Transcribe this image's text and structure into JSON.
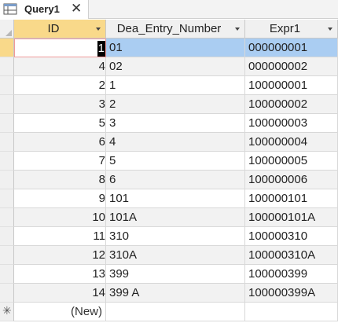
{
  "tab": {
    "title": "Query1",
    "close_glyph": "✕",
    "icon": "query-icon"
  },
  "columns": [
    {
      "label": "ID"
    },
    {
      "label": "Dea_Entry_Number"
    },
    {
      "label": "Expr1"
    }
  ],
  "rows": [
    {
      "id": "1",
      "dea": "01",
      "expr": "000000001"
    },
    {
      "id": "4",
      "dea": "02",
      "expr": "000000002"
    },
    {
      "id": "2",
      "dea": "1",
      "expr": "100000001"
    },
    {
      "id": "3",
      "dea": "2",
      "expr": "100000002"
    },
    {
      "id": "5",
      "dea": "3",
      "expr": "100000003"
    },
    {
      "id": "6",
      "dea": "4",
      "expr": "100000004"
    },
    {
      "id": "7",
      "dea": "5",
      "expr": "100000005"
    },
    {
      "id": "8",
      "dea": "6",
      "expr": "100000006"
    },
    {
      "id": "9",
      "dea": "101",
      "expr": "100000101"
    },
    {
      "id": "10",
      "dea": "101A",
      "expr": "100000101A"
    },
    {
      "id": "11",
      "dea": "310",
      "expr": "100000310"
    },
    {
      "id": "12",
      "dea": "310A",
      "expr": "100000310A"
    },
    {
      "id": "13",
      "dea": "399",
      "expr": "100000399"
    },
    {
      "id": "14",
      "dea": "399 A",
      "expr": "100000399A"
    }
  ],
  "new_row": {
    "marker": "✳",
    "id_placeholder": "(New)"
  },
  "colors": {
    "selected_header": "#f9d98a",
    "selected_row": "#aacdf2",
    "alt_row": "#f2f2f2"
  }
}
